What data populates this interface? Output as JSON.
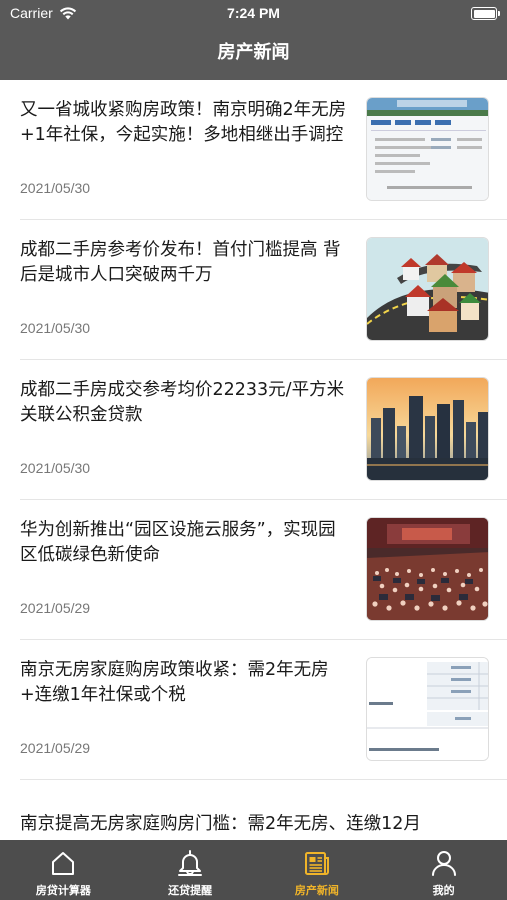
{
  "status_bar": {
    "carrier": "Carrier",
    "time": "7:24 PM"
  },
  "nav": {
    "title": "房产新闻"
  },
  "news": [
    {
      "title": "又一省城收紧购房政策！南京明确2年无房+1年社保，今起实施！多地相继出手调控",
      "date": "2021/05/30",
      "thumb": "document-screenshot"
    },
    {
      "title": "成都二手房参考价发布！首付门槛提高 背后是城市人口突破两千万",
      "date": "2021/05/30",
      "thumb": "houses-illustration"
    },
    {
      "title": "成都二手房成交参考均价22233元/平方米 关联公积金贷款",
      "date": "2021/05/30",
      "thumb": "city-skyline"
    },
    {
      "title": "华为创新推出“园区设施云服务”，实现园区低碳绿色新使命",
      "date": "2021/05/29",
      "thumb": "conference-hall"
    },
    {
      "title": "南京无房家庭购房政策收紧：需2年无房+连缴1年社保或个税",
      "date": "2021/05/29",
      "thumb": "form-screenshot"
    },
    {
      "title": "南京提高无房家庭购房门槛：需2年无房、连缴12月",
      "date": "",
      "thumb": ""
    }
  ],
  "tabbar": {
    "items": [
      {
        "label": "房贷计算器",
        "icon": "house-icon",
        "active": false
      },
      {
        "label": "还贷提醒",
        "icon": "bell-icon",
        "active": false
      },
      {
        "label": "房产新闻",
        "icon": "newspaper-icon",
        "active": true
      },
      {
        "label": "我的",
        "icon": "person-icon",
        "active": false
      }
    ]
  },
  "colors": {
    "header": "#595959",
    "tabbar": "#4d4d4d",
    "active_tab": "#f0b429"
  }
}
